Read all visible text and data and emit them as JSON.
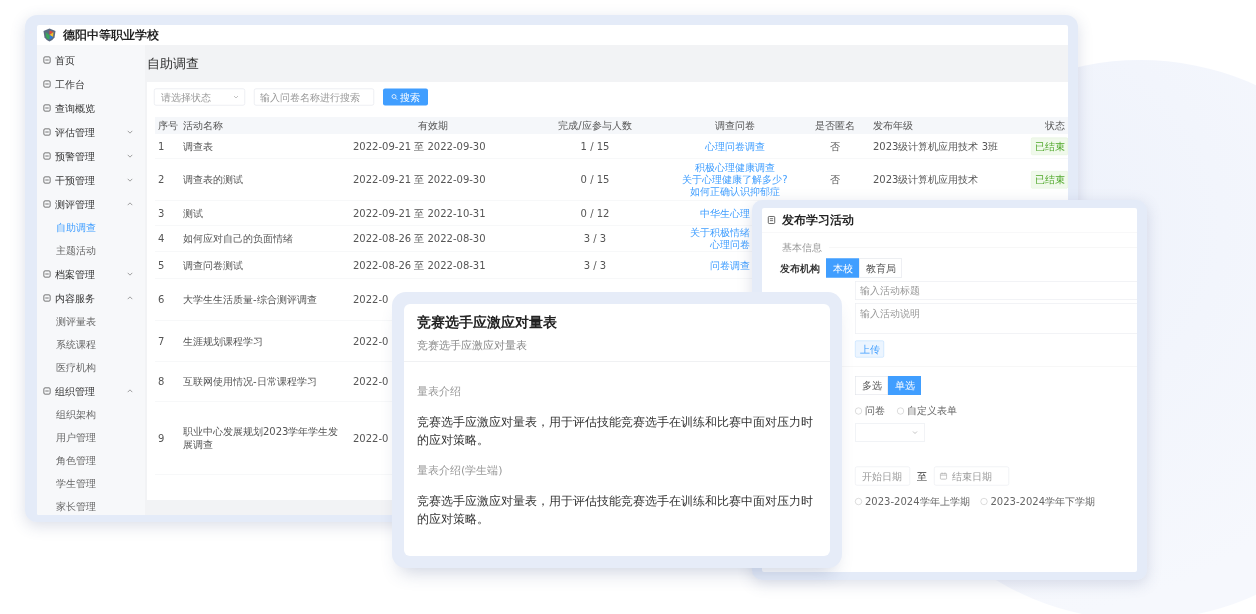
{
  "main_window": {
    "school_name": "德阳中等职业学校",
    "sidebar": {
      "items": [
        {
          "label": "首页",
          "selected": false
        },
        {
          "label": "工作台",
          "selected": false
        },
        {
          "label": "查询概览",
          "selected": false
        },
        {
          "label": "评估管理",
          "selected": false,
          "expanded": false
        },
        {
          "label": "预警管理",
          "selected": false,
          "expanded": false
        },
        {
          "label": "干预管理",
          "selected": false,
          "expanded": false
        },
        {
          "label": "测评管理",
          "selected": false,
          "expanded": true,
          "children": [
            {
              "label": "自助调查",
              "selected": true
            },
            {
              "label": "主题活动",
              "selected": false
            }
          ]
        },
        {
          "label": "档案管理",
          "selected": false,
          "expanded": false
        },
        {
          "label": "内容服务",
          "selected": false,
          "expanded": true,
          "children": [
            {
              "label": "测评量表",
              "selected": false
            },
            {
              "label": "系统课程",
              "selected": false
            },
            {
              "label": "医疗机构",
              "selected": false
            }
          ]
        },
        {
          "label": "组织管理",
          "selected": false,
          "expanded": true,
          "children": [
            {
              "label": "组织架构",
              "selected": false
            },
            {
              "label": "用户管理",
              "selected": false
            },
            {
              "label": "角色管理",
              "selected": false
            },
            {
              "label": "学生管理",
              "selected": false
            },
            {
              "label": "家长管理",
              "selected": false
            }
          ]
        }
      ]
    },
    "page_title": "自助调查",
    "filters": {
      "status_placeholder": "请选择状态",
      "search_placeholder": "输入问卷名称进行搜索",
      "search_button": "搜索"
    },
    "table": {
      "columns": [
        "序号",
        "活动名称",
        "有效期",
        "完成/应参与人数",
        "调查问卷",
        "是否匿名",
        "发布年级",
        "状态"
      ],
      "rows": [
        {
          "index": "1",
          "name": "调查表",
          "period": "2022-09-21 至 2022-09-30",
          "count": "1 / 15",
          "surveys": [
            "心理问卷调查"
          ],
          "anonymous": "否",
          "grade": "2023级计算机应用技术 3班",
          "status": "已结束"
        },
        {
          "index": "2",
          "name": "调查表的测试",
          "period": "2022-09-21 至 2022-09-30",
          "count": "0 / 15",
          "surveys": [
            "积极心理健康调查",
            "关于心理健康了解多少?",
            "如何正确认识抑郁症"
          ],
          "anonymous": "否",
          "grade": "2023级计算机应用技术",
          "status": "已结束"
        },
        {
          "index": "3",
          "name": "测试",
          "period": "2022-09-21 至 2022-10-31",
          "count": "0 / 12",
          "surveys": [
            "中华生心理"
          ]
        },
        {
          "index": "4",
          "name": "如何应对自己的负面情绪",
          "period": "2022-08-26 至 2022-08-30",
          "count": "3 / 3",
          "surveys": [
            "关于积极情绪",
            "心理问卷"
          ]
        },
        {
          "index": "5",
          "name": "调查问卷测试",
          "period": "2022-08-26 至 2022-08-31",
          "count": "3 / 3",
          "surveys": [
            "问卷调查"
          ]
        },
        {
          "index": "6",
          "name": "大学生生活质量-综合测评调查",
          "period": "2022-0"
        },
        {
          "index": "7",
          "name": "生涯规划课程学习",
          "period": "2022-0"
        },
        {
          "index": "8",
          "name": "互联网使用情况-日常课程学习",
          "period": "2022-0"
        },
        {
          "index": "9",
          "name": "职业中心发展规划2023学年学生发展调查",
          "period": "2022-0"
        }
      ]
    }
  },
  "scale_card": {
    "title": "竞赛选手应激应对量表",
    "subtitle": "竞赛选手应激应对量表",
    "sections": [
      {
        "heading": "量表介绍",
        "text": "竞赛选手应激应对量表，用于评估技能竞赛选手在训练和比赛中面对压力时的应对策略。"
      },
      {
        "heading": "量表介绍(学生端)",
        "text": "竞赛选手应激应对量表，用于评估技能竞赛选手在训练和比赛中面对压力时的应对策略。"
      }
    ]
  },
  "publish_dialog": {
    "title": "发布学习活动",
    "section": "基本信息",
    "org_label": "发布机构",
    "org_options": [
      {
        "label": "本校",
        "selected": true
      },
      {
        "label": "教育局",
        "selected": false
      }
    ],
    "title_placeholder": "输入活动标题",
    "description_placeholder": "输入活动说明",
    "upload_button": "上传",
    "choice_options": [
      {
        "label": "多选",
        "selected": false
      },
      {
        "label": "单选",
        "selected": true
      }
    ],
    "type_options": [
      {
        "label": "问卷",
        "selected": false
      },
      {
        "label": "自定义表单",
        "selected": false
      }
    ],
    "start_placeholder": "开始日期",
    "range_separator": "至",
    "end_placeholder": "结束日期",
    "term_options": [
      {
        "label": "2023-2024学年上学期",
        "selected": false
      },
      {
        "label": "2023-2024学年下学期",
        "selected": false
      }
    ]
  }
}
